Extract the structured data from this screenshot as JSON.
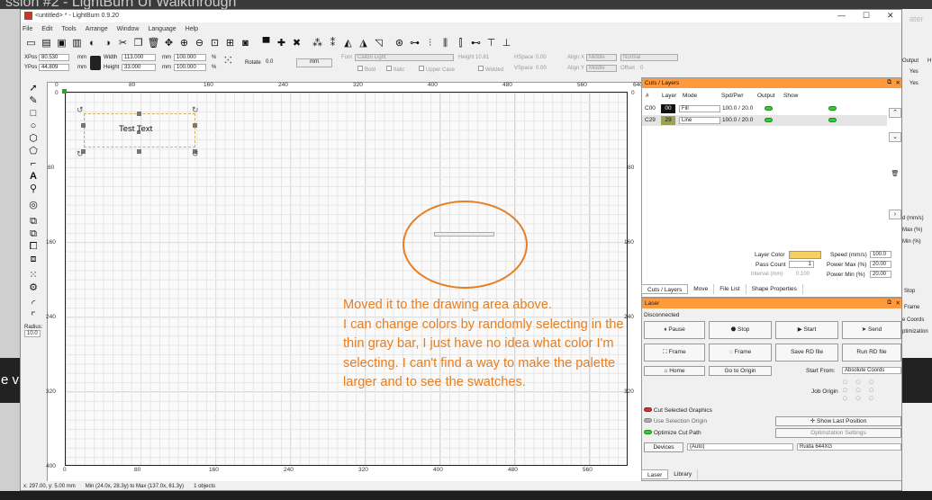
{
  "background": {
    "top_text": "ssion #2 - LightBurn UI Walkthrough",
    "left_banner_text": "e v",
    "right_texts": {
      "ater": "ater",
      "output": "Output",
      "h": "H",
      "yes1": "Yes",
      "yes2": "Yes",
      "mm_s": "d (mm/s)",
      "max": "Max (%)",
      "min": "Min (%)",
      "stop": "Stop",
      "frame": "Frame",
      "coords": "e Coords",
      "optim": "ptimization"
    }
  },
  "window": {
    "title": "<untitled> * - LightBurn 0.9.20",
    "controls": {
      "minimize": "—",
      "maximize": "☐",
      "close": "✕"
    },
    "menu": [
      "File",
      "Edit",
      "Tools",
      "Arrange",
      "Window",
      "Language",
      "Help"
    ]
  },
  "toolbar1_icons": [
    "open-icon",
    "import-icon",
    "save-icon",
    "undo-icon",
    "redo-icon",
    "cut-icon",
    "copy-icon",
    "paste-icon",
    "delete-icon",
    "move-icon",
    "zoom-in-icon",
    "zoom-out-icon",
    "zoom-frame-icon",
    "zoom-page-icon",
    "camera-icon",
    "monitor-icon",
    "tools-icon",
    "settings-icon",
    "group-icon",
    "ungroup-icon",
    "mirror-h-icon",
    "mirror-v-icon",
    "rotate-icon",
    "align-icon",
    "dist-h-icon",
    "dist-v-icon",
    "move-laser-icon",
    "array-icon"
  ],
  "toolbar2": {
    "xpos_label": "XPos",
    "xpos_value": "80.530",
    "ypos_label": "YPos",
    "ypos_value": "44.809",
    "unit": "mm",
    "width_label": "Width",
    "width_value": "113.000",
    "height_label": "Height",
    "height_value": "33.000",
    "scale_w": "100.000",
    "scale_h": "100.000",
    "pct": "%",
    "rotate_label": "Rotate",
    "rotate_value": "0.0",
    "mm_button": "mm",
    "font_label": "Font",
    "font_value": "Calibri Light",
    "height2_label": "Height",
    "height2_value": "10.81",
    "hspace_label": "HSpace",
    "hspace_value": "0.00",
    "vspace_label": "VSpace",
    "vspace_value": "0.00",
    "bold": "Bold",
    "italic": "Italic",
    "upper": "Upper Case",
    "welded": "Welded",
    "alignx_label": "Align X",
    "alignx_value": "Middle",
    "aligny_label": "Align Y",
    "aligny_value": "Middle",
    "normal": "Normal",
    "offset_label": "Offset",
    "offset_value": "0"
  },
  "left_tools": [
    "select-icon",
    "pen-icon",
    "rectangle-icon",
    "ellipse-icon",
    "polygon-icon",
    "shape-icon",
    "corner-icon",
    "text-icon",
    "position-icon",
    "circle-ring-icon",
    "boolean1-icon",
    "boolean2-icon",
    "boolean3-icon",
    "boolean4-icon",
    "grid-array-icon",
    "settings-gear-icon",
    "round-corner-icon",
    "corner2-icon"
  ],
  "radius_label": "Radius:",
  "radius_value": "10.0",
  "rulers": {
    "top": [
      "0",
      "80",
      "160",
      "240",
      "320",
      "400",
      "480",
      "560",
      "640"
    ],
    "bottom": [
      "0",
      "80",
      "160",
      "240",
      "320",
      "400",
      "480",
      "560",
      "640"
    ],
    "left": [
      "0",
      "80",
      "160",
      "240",
      "320",
      "400"
    ],
    "right": [
      "0",
      "80",
      "160",
      "240",
      "320"
    ]
  },
  "canvas": {
    "text_object": "Test Text",
    "annotation": "Moved it to the drawing area above.\nI can change colors by randomly selecting in the thin gray bar, I just have no idea what color I'm selecting. I can't find a way to make the palette larger and to see the swatches."
  },
  "status": {
    "coords": "x: 297.00, y: 5.00 mm",
    "range": "Min (24.0x, 28.3y) to Max (137.0x, 61.3y)",
    "objects": "1 objects"
  },
  "cuts": {
    "title": "Cuts / Layers",
    "headers": [
      "#",
      "Layer",
      "Mode",
      "Spd/Pwr",
      "Output",
      "Show"
    ],
    "rows": [
      {
        "id": "C00",
        "layer": "00",
        "color": "#111111",
        "mode": "Fill",
        "spdpwr": "100.0 / 20.0"
      },
      {
        "id": "C29",
        "layer": "29",
        "color": "#9aa25a",
        "mode": "Line",
        "spdpwr": "100.0 / 20.0"
      }
    ],
    "layer_color_label": "Layer Color",
    "layer_color": "#f5d060",
    "speed_label": "Speed (mm/s)",
    "speed_value": "100.0",
    "pass_label": "Pass Count",
    "pass_value": "1",
    "pmax_label": "Power Max (%)",
    "pmax_value": "20.00",
    "interval_label": "Interval (mm)",
    "interval_value": "0.100",
    "pmin_label": "Power Min (%)",
    "pmin_value": "20.00"
  },
  "tabs_top": [
    "Cuts / Layers",
    "Move",
    "File List",
    "Shape Properties"
  ],
  "laser": {
    "title": "Laser",
    "status": "Disconnected",
    "pause": "Pause",
    "stop": "Stop",
    "start": "Start",
    "send": "Send",
    "frame1": "Frame",
    "frame2": "Frame",
    "save_rd": "Save RD file",
    "run_rd": "Run RD file",
    "home": "Home",
    "go_origin": "Go to Origin",
    "start_from_label": "Start From:",
    "start_from_value": "Absolute Coords",
    "job_origin": "Job Origin",
    "cut_selected": "Cut Selected Graphics",
    "use_selection_origin": "Use Selection Origin",
    "show_last": "Show Last Position",
    "optimize": "Optimize Cut Path",
    "opt_settings": "Optimization Settings",
    "devices": "Devices",
    "auto": "(Auto)",
    "device": "Ruida 644XG"
  },
  "tabs_bottom": [
    "Laser",
    "Library"
  ]
}
